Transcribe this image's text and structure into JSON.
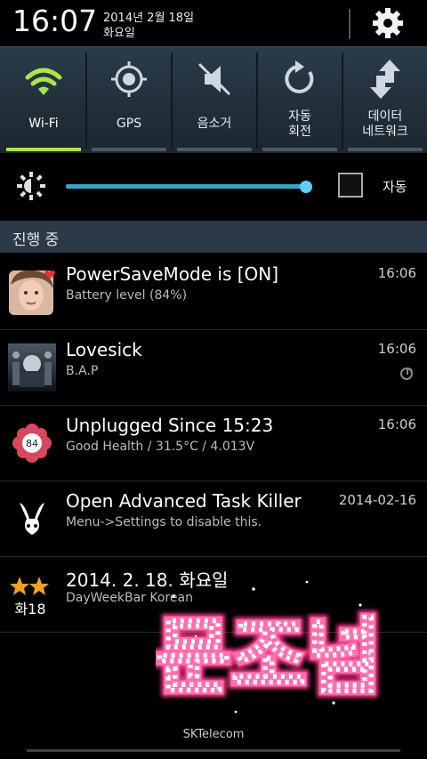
{
  "status_bar": {
    "time": "16:07",
    "date_line1": "2014년 2월 18일",
    "date_line2": "화요일",
    "settings_icon": "gear-icon"
  },
  "quick_settings": [
    {
      "label": "Wi-Fi",
      "icon": "wifi-icon",
      "active": true
    },
    {
      "label": "GPS",
      "icon": "gps-icon",
      "active": false
    },
    {
      "label": "음소거",
      "icon": "mute-icon",
      "active": false
    },
    {
      "label_line1": "자동",
      "label_line2": "회전",
      "icon": "rotate-icon",
      "active": false
    },
    {
      "label_line1": "데이터",
      "label_line2": "네트워크",
      "icon": "data-network-icon",
      "active": false
    }
  ],
  "brightness": {
    "level_fraction": 0.98,
    "auto_label": "자동",
    "auto_checked": false
  },
  "section_header": "진행 중",
  "notifications": [
    {
      "title": "PowerSaveMode is [ON]",
      "subtitle": "Battery level (84%)",
      "time": "16:06",
      "icon": "person-avatar-icon"
    },
    {
      "title": "Lovesick",
      "subtitle": "B.A.P",
      "time": "16:06",
      "icon": "album-art-icon",
      "mini_icon": "music-note-icon"
    },
    {
      "title": "Unplugged Since 15:23",
      "subtitle": "Good Health / 31.5°C / 4.013V",
      "time": "16:06",
      "icon": "battery-flower-icon",
      "icon_text": "84"
    },
    {
      "title": "Open Advanced Task Killer",
      "subtitle": "Menu->Settings to disable this.",
      "time": "2014-02-16",
      "icon": "bunny-logo-icon"
    },
    {
      "title": "2014. 2. 18. 화요일",
      "subtitle": "DayWeekBar Korean",
      "time": "",
      "icon": "star-calendar-icon",
      "icon_text": "화18"
    }
  ],
  "decor_text": "문조넘",
  "carrier": "SKTelecom",
  "colors": {
    "accent_green": "#a8e64a",
    "slider_blue": "#3aa4c7",
    "panel_bg": "#2b3a46"
  }
}
